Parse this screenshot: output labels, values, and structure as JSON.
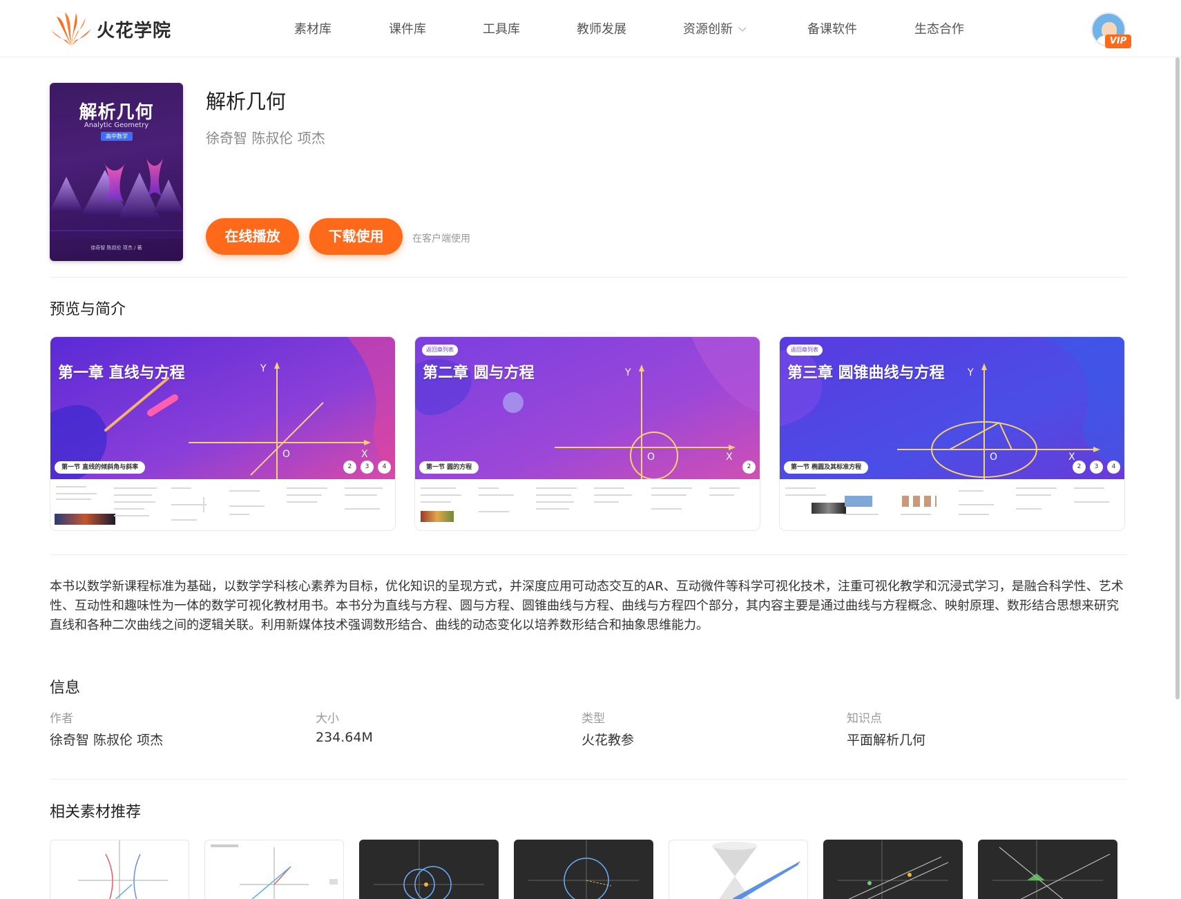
{
  "header": {
    "logo_text": "火花学院",
    "nav": [
      "素材库",
      "课件库",
      "工具库",
      "教师发展",
      "资源创新",
      "备课软件",
      "生态合作"
    ],
    "vip_label": "VIP"
  },
  "book": {
    "cover_title": "解析几何",
    "cover_subtitle": "Analytic Geometry",
    "cover_tag": "高中数学",
    "cover_authors": "徐奇智 陈叔伦 项杰 / 著",
    "title": "解析几何",
    "authors": "徐奇智 陈叔伦 项杰",
    "play_label": "在线播放",
    "download_label": "下载使用",
    "client_note": "在客户端使用"
  },
  "preview": {
    "heading": "预览与简介",
    "cards": [
      {
        "chapter": "第一章  直线与方程",
        "badge": "",
        "section": "第一节  直线的倾斜角与斜率",
        "pages": [
          "2",
          "3",
          "4"
        ],
        "axis_y": "Y",
        "axis_x": "X",
        "origin": "O"
      },
      {
        "chapter": "第二章  圆与方程",
        "badge": "返回章列表",
        "section": "第一节  圆的方程",
        "pages": [
          "2"
        ],
        "axis_y": "Y",
        "axis_x": "X",
        "origin": "O"
      },
      {
        "chapter": "第三章  圆锥曲线与方程",
        "badge": "返回章列表",
        "section": "第一节  椭圆及其标准方程",
        "pages": [
          "2",
          "3",
          "4"
        ],
        "axis_y": "Y",
        "axis_x": "X",
        "origin": "O"
      }
    ]
  },
  "description": "本书以数学新课程标准为基础，以数学学科核心素养为目标，优化知识的呈现方式，并深度应用可动态交互的AR、互动微件等科学可视化技术，注重可视化教学和沉浸式学习，是融合科学性、艺术性、互动性和趣味性为一体的数学可视化教材用书。本书分为直线与方程、圆与方程、圆锥曲线与方程、曲线与方程四个部分，其内容主要是通过曲线与方程概念、映射原理、数形结合思想来研究直线和各种二次曲线之间的逻辑关联。利用新媒体技术强调数形结合、曲线的动态变化以培养数形结合和抽象思维能力。",
  "info": {
    "heading": "信息",
    "author_label": "作者",
    "author_value": "徐奇智 陈叔伦 项杰",
    "size_label": "大小",
    "size_value": "234.64M",
    "type_label": "类型",
    "type_value": "火花教参",
    "topic_label": "知识点",
    "topic_value": "平面解析几何"
  },
  "related": {
    "heading": "相关素材推荐"
  },
  "colors": {
    "accent": "#ff6a1a",
    "card_purple": "#7a3fe0"
  }
}
